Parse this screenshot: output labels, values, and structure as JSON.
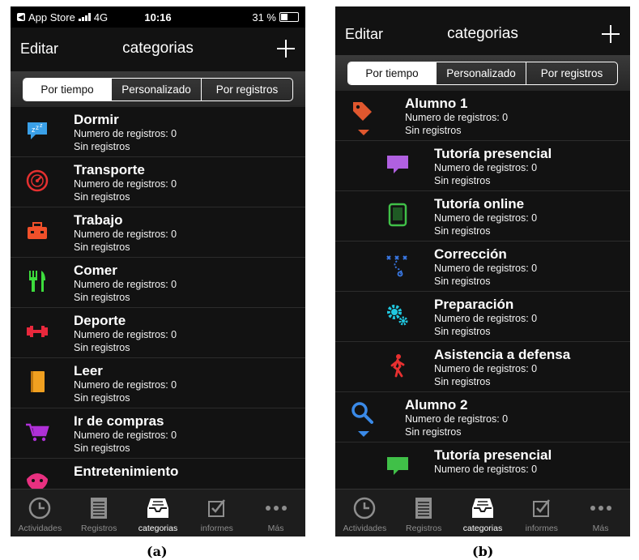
{
  "panel_a": {
    "status": {
      "carrier": "App Store",
      "network": "4G",
      "time": "10:16",
      "battery": "31 %"
    },
    "nav": {
      "edit": "Editar",
      "title": "categorias"
    },
    "segments": [
      "Por tiempo",
      "Personalizado",
      "Por registros"
    ],
    "rows": [
      {
        "name": "Dormir",
        "sub1": "Numero de registros: 0",
        "sub2": "Sin registros",
        "icon": "sleep-bubble-icon",
        "color": "#3aa0e8"
      },
      {
        "name": "Transporte",
        "sub1": "Numero de registros: 0",
        "sub2": "Sin registros",
        "icon": "speedometer-icon",
        "color": "#e53030"
      },
      {
        "name": "Trabajo",
        "sub1": "Numero de registros: 0",
        "sub2": "Sin registros",
        "icon": "toolbox-icon",
        "color": "#f0502a"
      },
      {
        "name": "Comer",
        "sub1": "Numero de registros: 0",
        "sub2": "Sin registros",
        "icon": "fork-knife-icon",
        "color": "#3ddc3d"
      },
      {
        "name": "Deporte",
        "sub1": "Numero de registros: 0",
        "sub2": "Sin registros",
        "icon": "dumbbell-icon",
        "color": "#e8283c"
      },
      {
        "name": "Leer",
        "sub1": "Numero de registros: 0",
        "sub2": "Sin registros",
        "icon": "book-icon",
        "color": "#f0a020"
      },
      {
        "name": "Ir de compras",
        "sub1": "Numero de registros: 0",
        "sub2": "Sin registros",
        "icon": "cart-icon",
        "color": "#b030d8"
      },
      {
        "name": "Entretenimiento",
        "sub1": "",
        "sub2": "",
        "icon": "mask-icon",
        "color": "#e83080"
      }
    ],
    "tabs": [
      "Actividades",
      "Registros",
      "categorias",
      "informes",
      "Más"
    ]
  },
  "panel_b": {
    "nav": {
      "edit": "Editar",
      "title": "categorias"
    },
    "segments": [
      "Por tiempo",
      "Personalizado",
      "Por registros"
    ],
    "rows": [
      {
        "type": "parent",
        "name": "Alumno 1",
        "sub1": "Numero de registros: 0",
        "sub2": "Sin registros",
        "icon": "tag-icon",
        "color": "#e0572e"
      },
      {
        "type": "child",
        "name": "Tutoría presencial",
        "sub1": "Numero de registros: 0",
        "sub2": "Sin registros",
        "icon": "speech-bubble-icon",
        "color": "#b060e0"
      },
      {
        "type": "child",
        "name": "Tutoría online",
        "sub1": "Numero de registros: 0",
        "sub2": "Sin registros",
        "icon": "tablet-icon",
        "color": "#40c048"
      },
      {
        "type": "child",
        "name": "Corrección",
        "sub1": "Numero de registros: 0",
        "sub2": "Sin registros",
        "icon": "strategy-icon",
        "color": "#3a7ae8"
      },
      {
        "type": "child",
        "name": "Preparación",
        "sub1": "Numero de registros: 0",
        "sub2": "Sin registros",
        "icon": "gears-icon",
        "color": "#20c8e0"
      },
      {
        "type": "child",
        "name": "Asistencia a defensa",
        "sub1": "Numero de registros: 0",
        "sub2": "Sin registros",
        "icon": "walking-person-icon",
        "color": "#e83030"
      },
      {
        "type": "parent",
        "name": "Alumno 2",
        "sub1": "Numero de registros: 0",
        "sub2": "Sin registros",
        "icon": "magnifier-icon",
        "color": "#3a8ae8"
      },
      {
        "type": "child",
        "name": "Tutoría presencial",
        "sub1": "Numero de registros: 0",
        "sub2": "",
        "icon": "speech-bubble-icon",
        "color": "#40c048"
      }
    ],
    "tabs": [
      "Actividades",
      "Registros",
      "categorias",
      "informes",
      "Más"
    ]
  },
  "captions": {
    "a": "(a)",
    "b": "(b)"
  }
}
